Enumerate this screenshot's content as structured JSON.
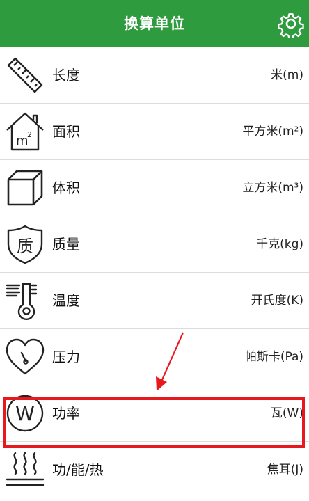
{
  "header": {
    "title": "换算单位",
    "settings_icon": "gear-icon"
  },
  "colors": {
    "header_bg": "#2e9b3e",
    "highlight": "#e8191e"
  },
  "rows": [
    {
      "label": "长度",
      "unit": "米(m)",
      "icon": "ruler-icon"
    },
    {
      "label": "面积",
      "unit": "平方米(m²)",
      "icon": "house-m2-icon"
    },
    {
      "label": "体积",
      "unit": "立方米(m³)",
      "icon": "cube-icon"
    },
    {
      "label": "质量",
      "unit": "千克(kg)",
      "icon": "shield-mass-icon"
    },
    {
      "label": "温度",
      "unit": "开氏度(K)",
      "icon": "thermometer-icon"
    },
    {
      "label": "压力",
      "unit": "帕斯卡(Pa)",
      "icon": "heart-gauge-icon"
    },
    {
      "label": "功率",
      "unit": "瓦(W)",
      "icon": "watt-circle-icon"
    },
    {
      "label": "功/能/热",
      "unit": "焦耳(J)",
      "icon": "heat-waves-icon"
    }
  ],
  "icon_text": {
    "area": "m",
    "area_sup": "2",
    "mass": "质",
    "power": "W"
  }
}
